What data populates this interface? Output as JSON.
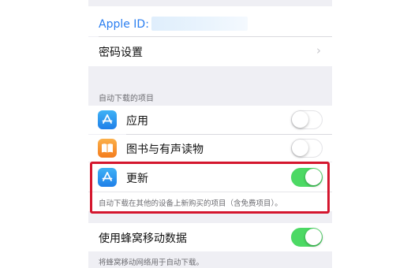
{
  "account": {
    "apple_id_label": "Apple ID:",
    "apple_id_value": ""
  },
  "password_settings": {
    "label": "密码设置"
  },
  "auto_downloads": {
    "header": "自动下载的项目",
    "items": [
      {
        "label": "应用",
        "icon": "app-store-icon",
        "enabled": false
      },
      {
        "label": "图书与有声读物",
        "icon": "books-icon",
        "enabled": false
      },
      {
        "label": "更新",
        "icon": "app-store-icon",
        "enabled": true
      }
    ],
    "footer": "自动下载在其他的设备上新购买的项目（含免费项目）。"
  },
  "cellular": {
    "label": "使用蜂窝移动数据",
    "enabled": true,
    "footer": "将蜂窝移动网络用于自动下载。"
  },
  "colors": {
    "toggle_on": "#4cd964",
    "link_blue": "#2a7ef0",
    "highlight_red": "#d4162e"
  }
}
